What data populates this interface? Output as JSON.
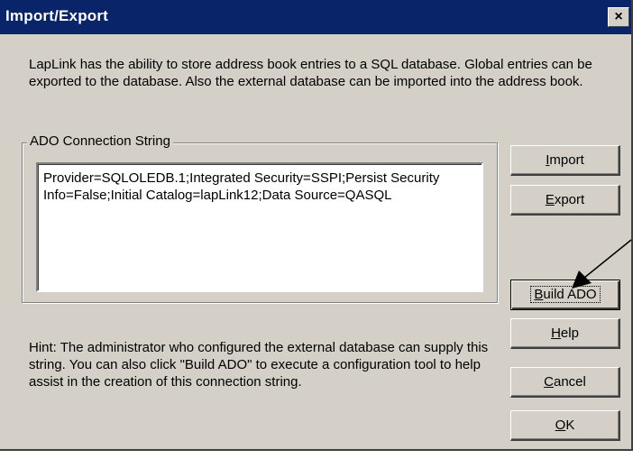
{
  "window": {
    "title": "Import/Export",
    "close_glyph": "×"
  },
  "description": "LapLink has the ability to store address book entries to a SQL database.  Global entries can be exported to the database.  Also the external database can be imported into the address book.",
  "connection_group": {
    "label": "ADO Connection String",
    "value": "Provider=SQLOLEDB.1;Integrated Security=SSPI;Persist Security Info=False;Initial Catalog=lapLink12;Data Source=QASQL"
  },
  "hint": "Hint:  The administrator who configured the external database can supply this string.  You can also click \"Build ADO\" to execute a configuration tool to help assist in the creation of this connection string.",
  "buttons": {
    "import": {
      "mnemonic": "I",
      "rest": "mport"
    },
    "export": {
      "mnemonic": "E",
      "rest": "xport"
    },
    "build_ado": {
      "mnemonic": "B",
      "rest": "uild ADO"
    },
    "help": {
      "mnemonic": "H",
      "rest": "elp"
    },
    "cancel": {
      "mnemonic": "C",
      "rest": "ancel"
    },
    "ok": {
      "mnemonic": "O",
      "rest": "K"
    }
  },
  "annotation": {
    "icon": "arrow-pointer-icon",
    "color": "#000000"
  }
}
